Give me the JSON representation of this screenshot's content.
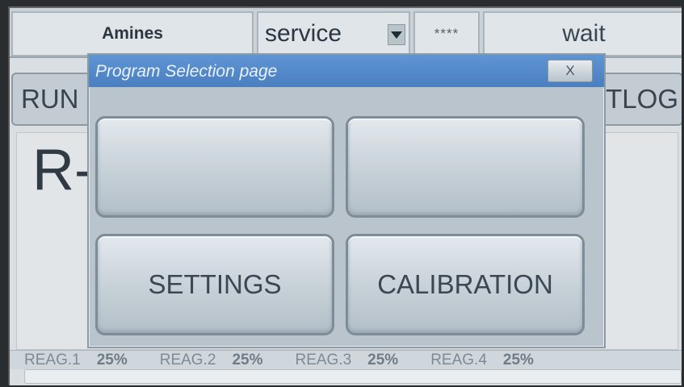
{
  "topbar": {
    "app_name": "Amines",
    "mode": "service",
    "password_mask": "****",
    "status": "wait"
  },
  "background": {
    "run_label": "RUN",
    "tlog_label": "TLOG",
    "big_text": "R-"
  },
  "dialog": {
    "title": "Program Selection page",
    "close_label": "X",
    "buttons": {
      "b1": "",
      "b2": "",
      "settings": "SETTINGS",
      "calibration": "CALIBRATION"
    }
  },
  "reagents": [
    {
      "label": "REAG.1",
      "value": "25%"
    },
    {
      "label": "REAG.2",
      "value": "25%"
    },
    {
      "label": "REAG.3",
      "value": "25%"
    },
    {
      "label": "REAG.4",
      "value": "25%"
    }
  ],
  "colors": {
    "title_bar": "#4a7fc0",
    "screen_bg": "#d9dee2"
  }
}
